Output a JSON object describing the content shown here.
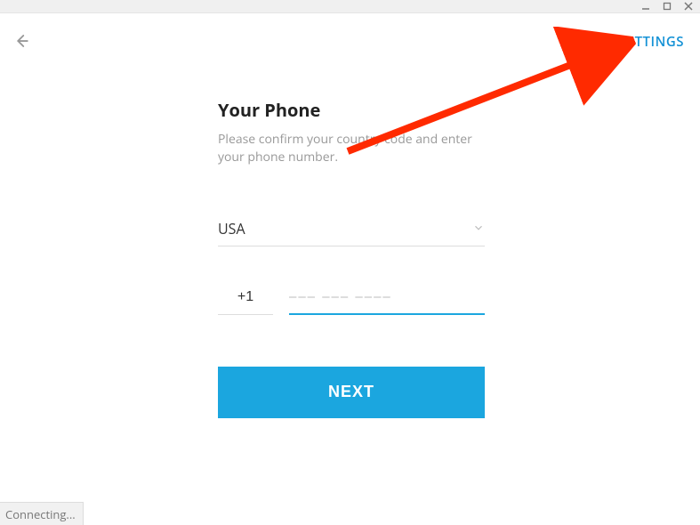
{
  "header": {
    "settings_label": "SETTINGS"
  },
  "form": {
    "heading": "Your Phone",
    "subtext": "Please confirm your country code and enter your phone number.",
    "country_selected": "USA",
    "country_code_value": "+1",
    "phone_placeholder": "––– ––– ––––",
    "next_label": "NEXT"
  },
  "status": {
    "text": "Connecting..."
  },
  "colors": {
    "accent": "#1ba6df",
    "link": "#1592d6",
    "annotation": "#ff2a00"
  }
}
